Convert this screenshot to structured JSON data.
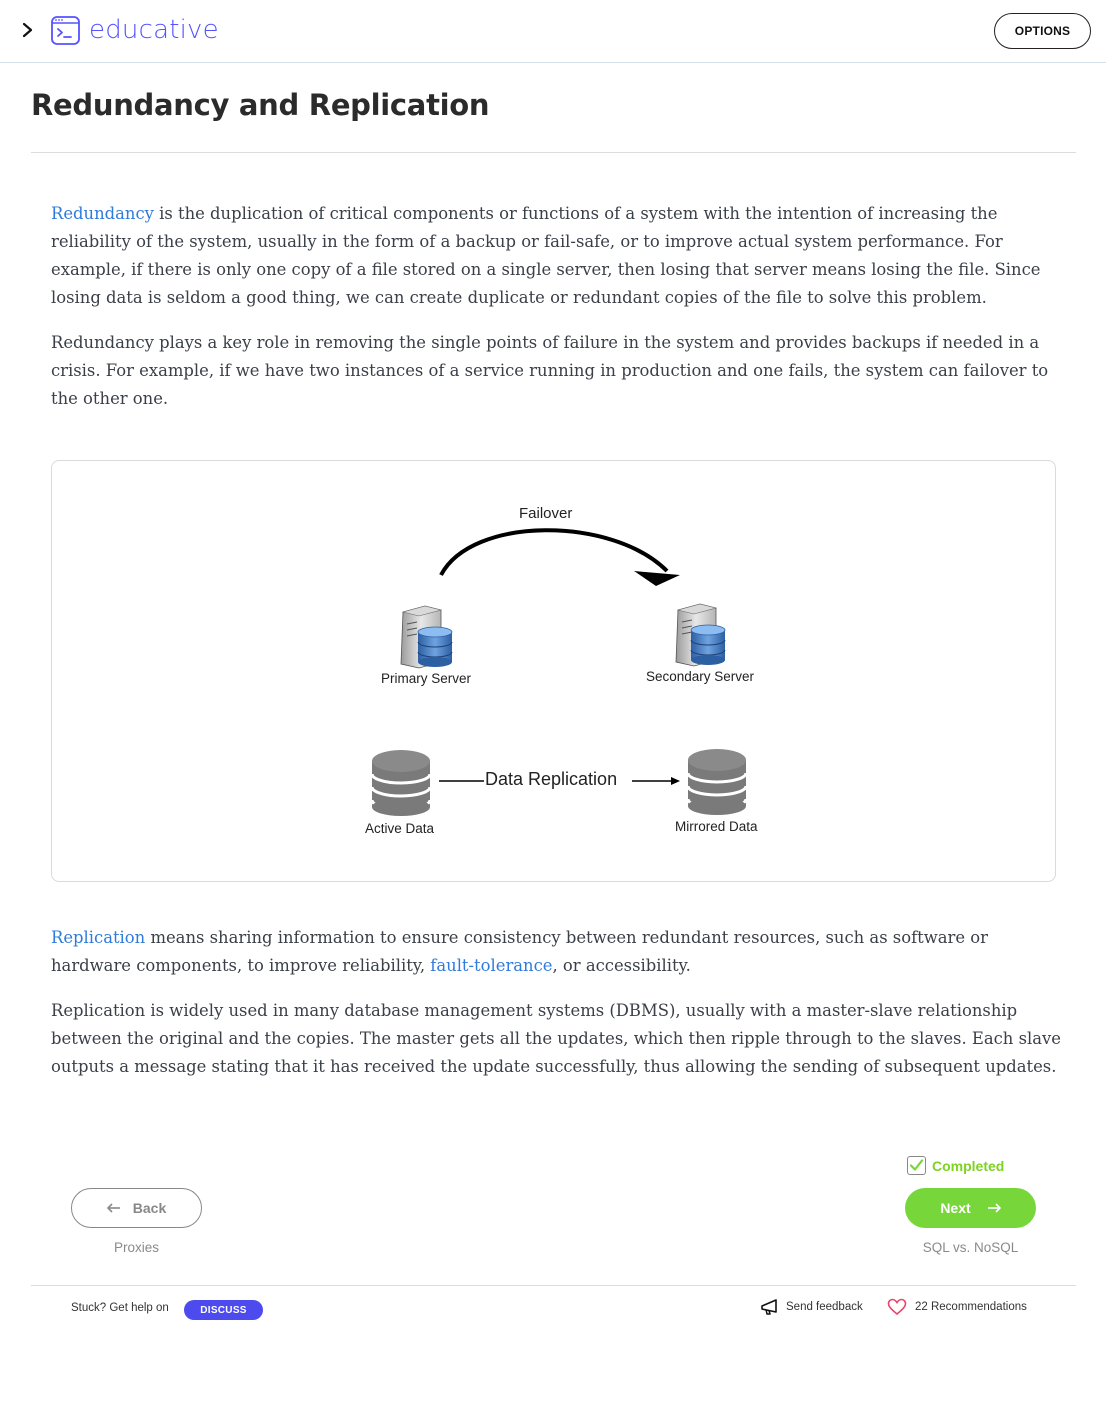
{
  "header": {
    "logo_text": "educative",
    "options_label": "OPTIONS"
  },
  "page": {
    "title": "Redundancy and Replication"
  },
  "content": {
    "p1": {
      "link": "Redundancy",
      "text": " is the duplication of critical components or functions of a system with the intention of increasing the reliability of the system, usually in the form of a backup or fail-safe, or to improve actual system performance. For example, if there is only one copy of a file stored on a single server, then losing that server means losing the file. Since losing data is seldom a good thing, we can create duplicate or redundant copies of the file to solve this problem."
    },
    "p2": "Redundancy plays a key role in removing the single points of failure in the system and provides backups if needed in a crisis. For example, if we have two instances of a service running in production and one fails, the system can failover to the other one.",
    "p3": {
      "link1": "Replication",
      "text1": " means sharing information to ensure consistency between redundant resources, such as software or hardware components, to improve reliability, ",
      "link2": "fault-tolerance",
      "text2": ", or accessibility."
    },
    "p4": "Replication is widely used in many database management systems (DBMS), usually with a master-slave relationship between the original and the copies. The master gets all the updates, which then ripple through to the slaves. Each slave outputs a message stating that it has received the update successfully, thus allowing the sending of subsequent updates."
  },
  "diagram": {
    "failover_label": "Failover",
    "primary_label": "Primary Server",
    "secondary_label": "Secondary Server",
    "replication_label": "Data Replication",
    "active_label": "Active Data",
    "mirrored_label": "Mirrored Data"
  },
  "navigation": {
    "completed_label": "Completed",
    "back_label": "Back",
    "next_label": "Next",
    "prev_title": "Proxies",
    "next_title": "SQL vs. NoSQL"
  },
  "footer": {
    "stuck_text": "Stuck? Get help on",
    "discuss_label": "DISCUSS",
    "feedback_label": "Send feedback",
    "recommendations_label": "22 Recommendations"
  },
  "colors": {
    "accent": "#5553ff",
    "link": "#2f7bdc",
    "success": "#77d63a",
    "discuss": "#4d4bee"
  },
  "icons": [
    "chevron-right-icon",
    "educative-logo-icon",
    "arrow-left-icon",
    "arrow-right-icon",
    "check-icon",
    "megaphone-icon",
    "heart-icon",
    "server-icon",
    "database-icon"
  ]
}
